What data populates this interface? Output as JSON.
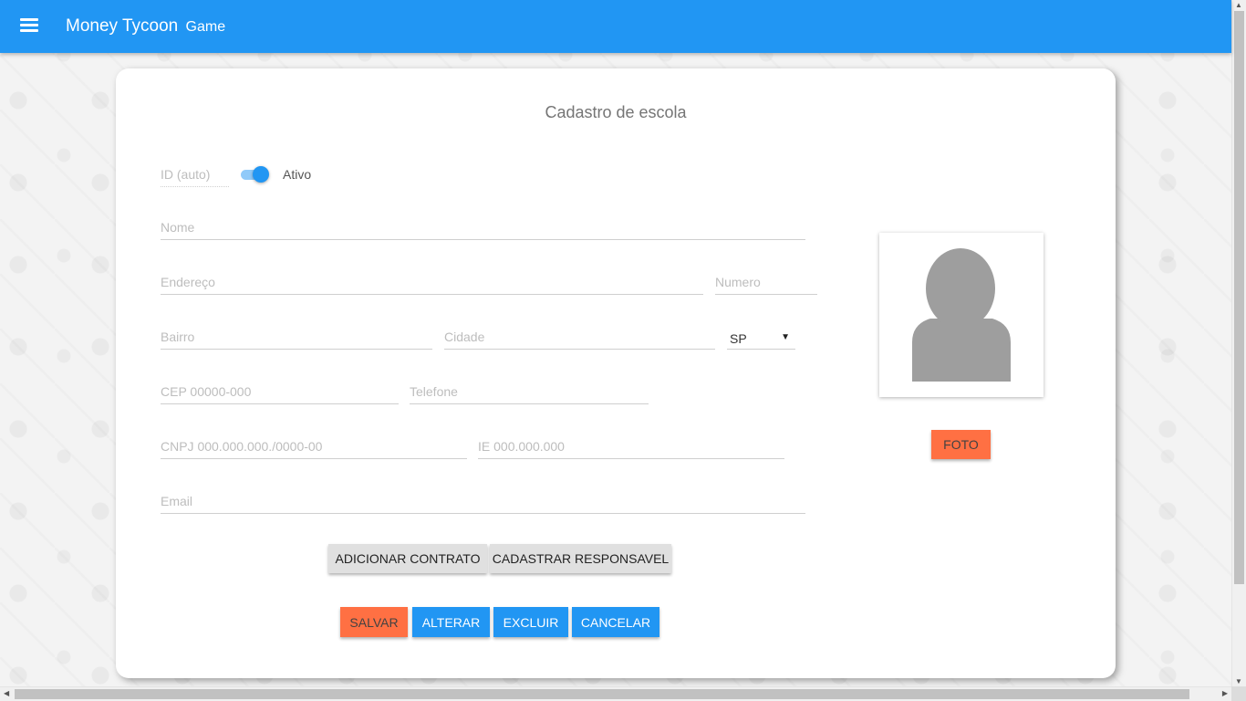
{
  "app": {
    "title": "Money Tycoon",
    "subtitle": "Game"
  },
  "form": {
    "title": "Cadastro de escola",
    "id_placeholder": "ID (auto)",
    "active_label": "Ativo",
    "active": true,
    "nome_placeholder": "Nome",
    "endereco_placeholder": "Endereço",
    "numero_placeholder": "Numero",
    "bairro_placeholder": "Bairro",
    "cidade_placeholder": "Cidade",
    "estado_value": "SP",
    "cep_placeholder": "CEP 00000-000",
    "telefone_placeholder": "Telefone",
    "cnpj_placeholder": "CNPJ 000.000.000./0000-00",
    "ie_placeholder": "IE 000.000.000",
    "email_placeholder": "Email"
  },
  "photo": {
    "button_label": "FOTO"
  },
  "actions": {
    "adicionar_contrato": "ADICIONAR CONTRATO",
    "cadastrar_responsavel": "CADASTRAR RESPONSAVEL",
    "salvar": "SALVAR",
    "alterar": "ALTERAR",
    "excluir": "EXCLUIR",
    "cancelar": "CANCELAR"
  },
  "colors": {
    "primary": "#2196f3",
    "accent": "#ff7043",
    "neutral_button": "#e0e0e0"
  }
}
